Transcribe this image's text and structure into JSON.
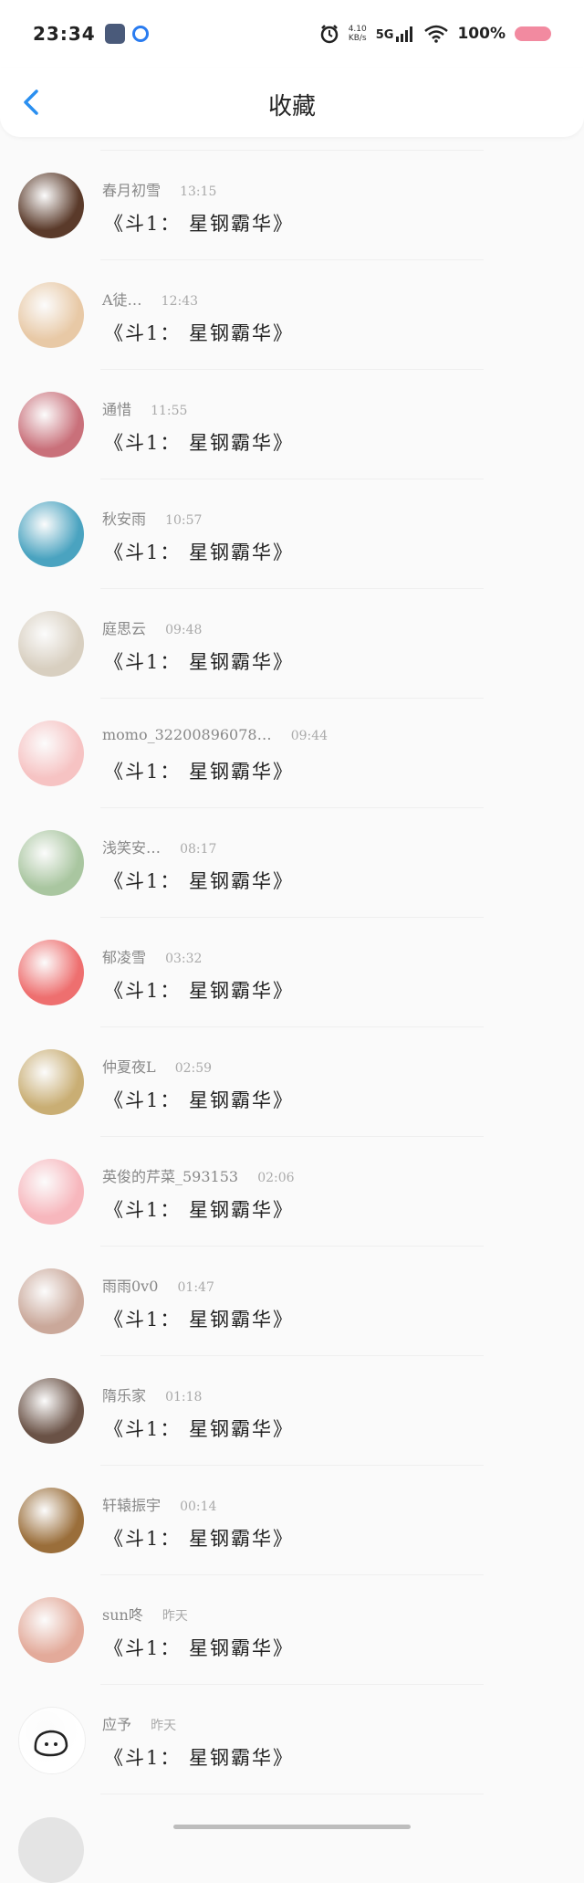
{
  "status_bar": {
    "time": "23:34",
    "speed_value": "4.10",
    "speed_unit": "KB/s",
    "signal_label": "5G",
    "battery_text": "100%",
    "battery_color": "#f28aa0",
    "icons": [
      "alarm-icon",
      "signal-icon",
      "wifi-icon",
      "battery-icon"
    ]
  },
  "header": {
    "title": "收藏",
    "back_icon": "chevron-left-icon",
    "accent": "#2a8ff0"
  },
  "items": [
    {
      "name": "春月初雪",
      "time": "13:15",
      "message": "《斗1：  星钢霸华》",
      "avatar_color": "#5a3a2a"
    },
    {
      "name": "A徒…",
      "time": "12:43",
      "message": "《斗1：  星钢霸华》",
      "avatar_color": "#e8c9a6"
    },
    {
      "name": "通惜",
      "time": "11:55",
      "message": "《斗1：  星钢霸华》",
      "avatar_color": "#c9707a"
    },
    {
      "name": "秋安雨",
      "time": "10:57",
      "message": "《斗1：  星钢霸华》",
      "avatar_color": "#4aa3c0"
    },
    {
      "name": "庭思云",
      "time": "09:48",
      "message": "《斗1：  星钢霸华》",
      "avatar_color": "#d8cfc0"
    },
    {
      "name": "momo_32200896078…",
      "time": "09:44",
      "message": "《斗1：  星钢霸华》",
      "avatar_color": "#f6c3c3"
    },
    {
      "name": "浅笑安…",
      "time": "08:17",
      "message": "《斗1：  星钢霸华》",
      "avatar_color": "#a9c6a0"
    },
    {
      "name": "郁凌雪",
      "time": "03:32",
      "message": "《斗1：  星钢霸华》",
      "avatar_color": "#ee6f6f"
    },
    {
      "name": "仲夏夜L",
      "time": "02:59",
      "message": "《斗1：  星钢霸华》",
      "avatar_color": "#c9ae74"
    },
    {
      "name": "英俊的芹菜_593153",
      "time": "02:06",
      "message": "《斗1：  星钢霸华》",
      "avatar_color": "#f7b7bd"
    },
    {
      "name": "雨雨0v0",
      "time": "01:47",
      "message": "《斗1：  星钢霸华》",
      "avatar_color": "#caa89a"
    },
    {
      "name": "隋乐家",
      "time": "01:18",
      "message": "《斗1：  星钢霸华》",
      "avatar_color": "#6a5246"
    },
    {
      "name": "轩辕振宇",
      "time": "00:14",
      "message": "《斗1：  星钢霸华》",
      "avatar_color": "#9a6e3a"
    },
    {
      "name": "sun咚",
      "time": "昨天",
      "message": "《斗1：  星钢霸华》",
      "avatar_color": "#e3aa9a"
    },
    {
      "name": "应予",
      "time": "昨天",
      "message": "《斗1：  星钢霸华》",
      "avatar_color": "#ffffff"
    }
  ]
}
